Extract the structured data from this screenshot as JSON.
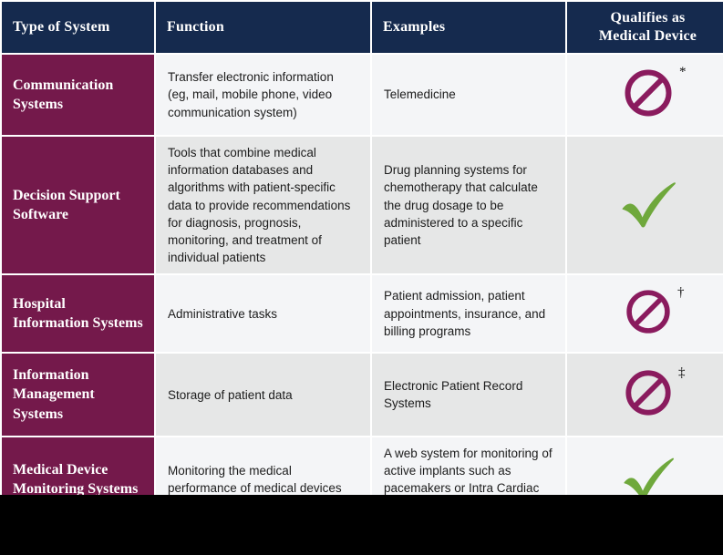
{
  "colors": {
    "header_bg": "#152a4e",
    "type_bg": "#74194b",
    "band_light": "#f4f5f7",
    "band_dark": "#e6e7e7",
    "no_symbol": "#8a1b5e",
    "check_symbol": "#6fa83c",
    "page_bg": "#000000"
  },
  "table": {
    "headers": [
      "Type of System",
      "Function",
      "Examples",
      "Qualifies as\nMedical Device"
    ],
    "header_qualifies_line1": "Qualifies as",
    "header_qualifies_line2": "Medical Device",
    "rows": [
      {
        "type": "Communication Systems",
        "function": "Transfer electronic information (eg, mail, mobile phone, video communication system)",
        "examples": "Telemedicine",
        "qualifies": "no",
        "qualifies_icon": "no-entry-icon",
        "footnote": "*"
      },
      {
        "type": "Decision Support Software",
        "function": "Tools that combine medical information databases and algorithms with patient-specific data to provide recommendations for diagnosis, prognosis, monitoring, and treatment of individual patients",
        "examples": "Drug planning systems for chemotherapy that calculate the drug dosage to be administered to a specific patient",
        "qualifies": "yes",
        "qualifies_icon": "check-mark-icon",
        "footnote": ""
      },
      {
        "type": "Hospital Information Systems",
        "function": "Administrative tasks",
        "examples": "Patient admission, patient appointments, insurance, and billing programs",
        "qualifies": "no",
        "qualifies_icon": "no-entry-icon",
        "footnote": "†"
      },
      {
        "type": "Information Management Systems",
        "function": "Storage of patient data",
        "examples": "Electronic Patient Record Systems",
        "qualifies": "no",
        "qualifies_icon": "no-entry-icon",
        "footnote": "‡"
      },
      {
        "type": "Medical Device Monitoring Systems",
        "function": "Monitoring the medical performance of medical devices",
        "examples": "A web system for monitoring of active implants such as pacemakers or Intra Cardiac Defibrillators",
        "qualifies": "yes",
        "qualifies_icon": "check-mark-icon",
        "footnote": ""
      }
    ]
  }
}
